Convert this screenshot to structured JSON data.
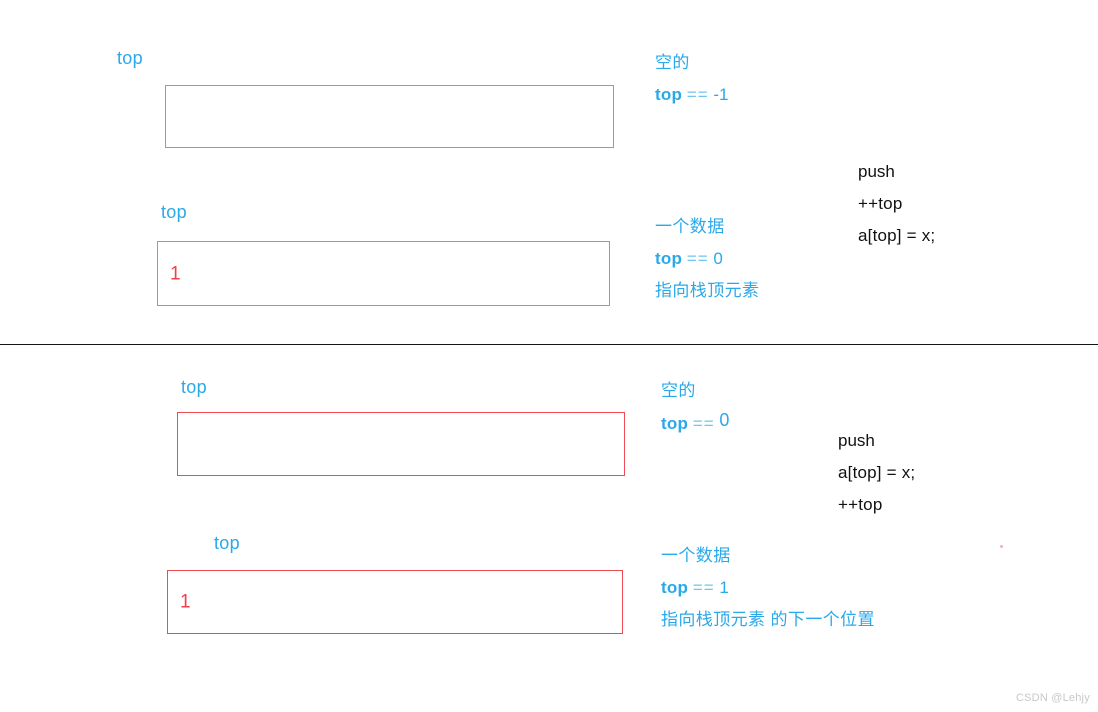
{
  "page": {
    "background": "#ffffff",
    "accent_blue": "#2aa9ea",
    "accent_red": "#ef4b55",
    "divider_color": "#141414",
    "watermark": "CSDN @Lehjy"
  },
  "sections": [
    {
      "id": "top-points-to-top-element",
      "empty_state": {
        "pointer_label": "top",
        "box_value": "",
        "notes": {
          "state": "空的",
          "var": "top",
          "op": "==",
          "value": "-1",
          "meaning": ""
        }
      },
      "one_item_state": {
        "pointer_label": "top",
        "box_value": "1",
        "notes": {
          "state": "一个数据",
          "var": "top",
          "op": "==",
          "value": "0",
          "meaning": "指向栈顶元素",
          "meaning_suffix": ""
        }
      },
      "code": {
        "title": "push",
        "lines": [
          "++top",
          "a[top] = x;"
        ]
      }
    },
    {
      "id": "top-points-to-next-free-slot",
      "empty_state": {
        "pointer_label": "top",
        "box_value": "",
        "notes": {
          "state": "空的",
          "var": "top",
          "op": "==",
          "value": "0",
          "meaning": ""
        }
      },
      "one_item_state": {
        "pointer_label": "top",
        "box_value": "1",
        "notes": {
          "state": "一个数据",
          "var": "top",
          "op": "==",
          "value": "1",
          "meaning": "指向栈顶元素",
          "meaning_suffix": " 的下一个位置"
        }
      },
      "code": {
        "title": "push",
        "lines": [
          "a[top] = x;",
          "++top"
        ]
      }
    }
  ]
}
